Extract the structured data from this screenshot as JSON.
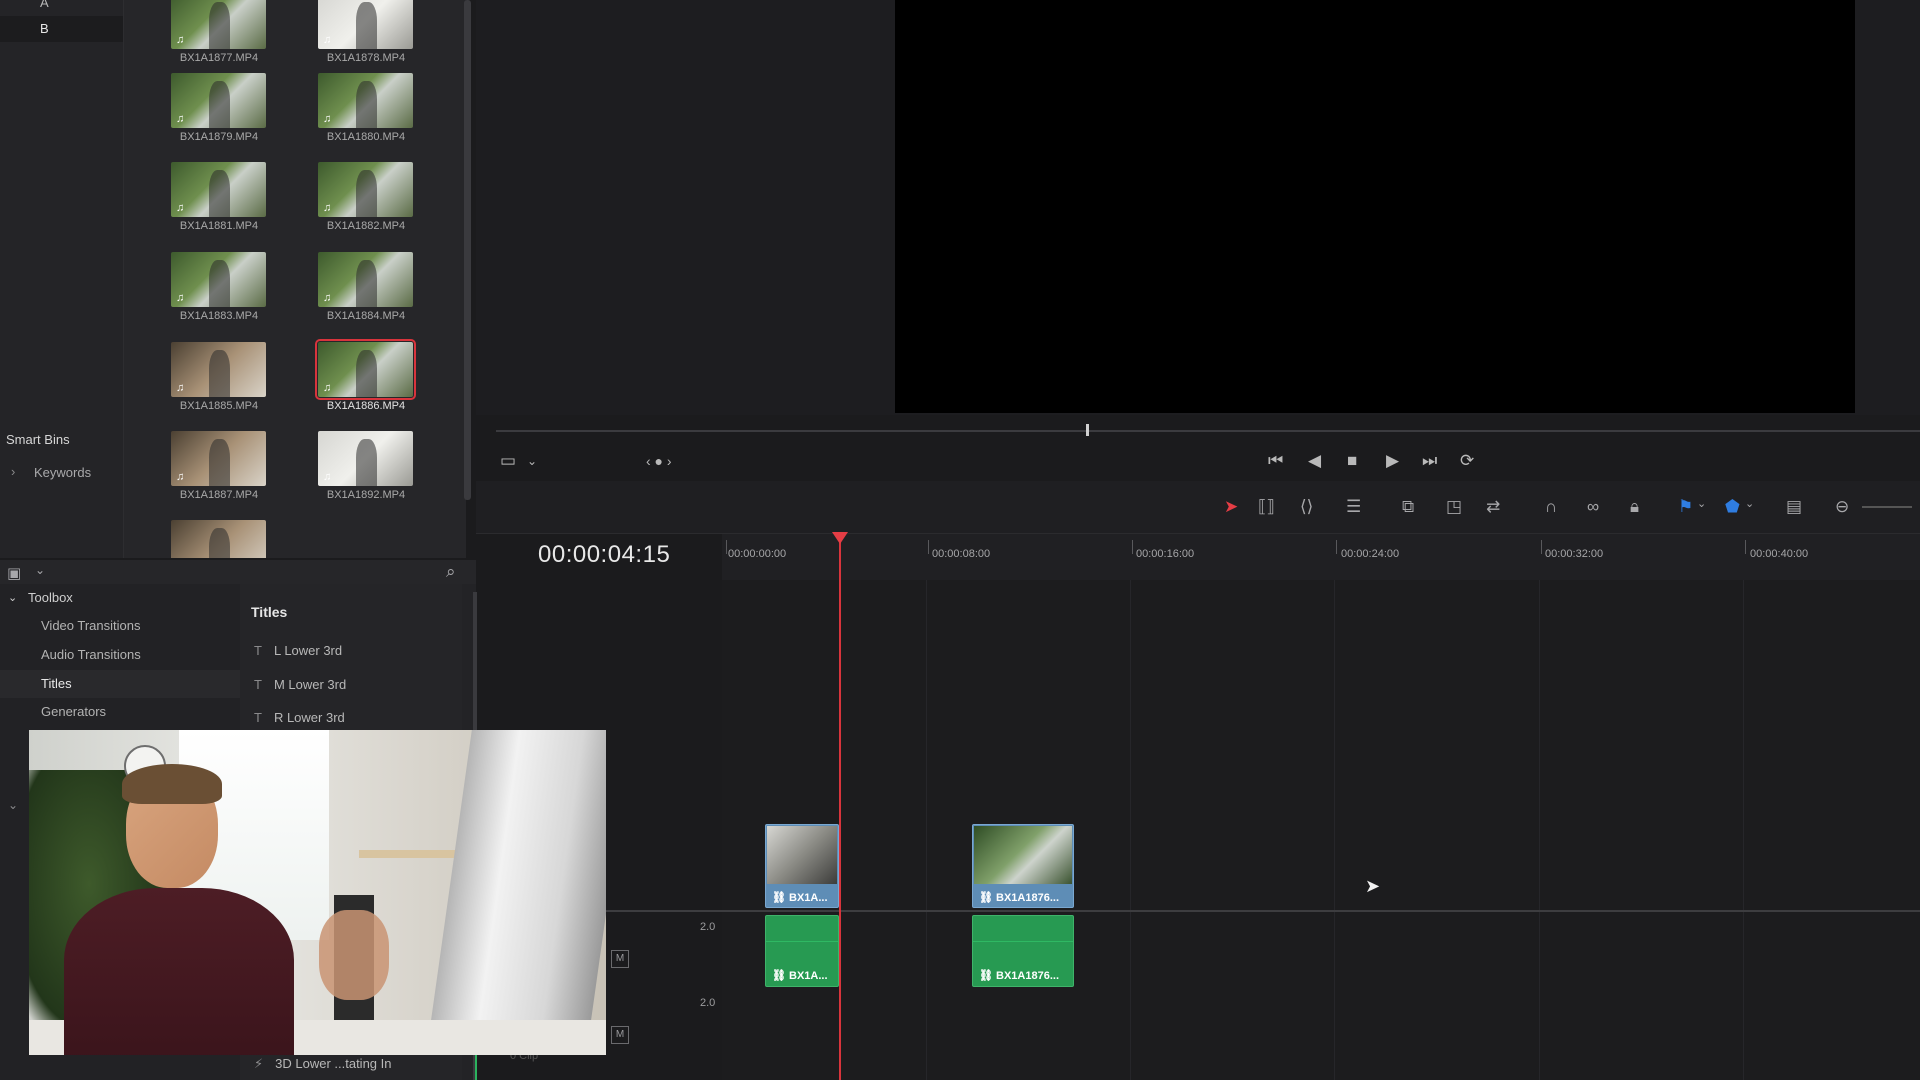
{
  "bins": {
    "items": [
      {
        "label": "A"
      },
      {
        "label": "B"
      }
    ],
    "selected": "B"
  },
  "smart_bins": {
    "heading": "Smart Bins",
    "keywords": "Keywords"
  },
  "media_pool": {
    "clips": [
      {
        "name": "BX1A1877.MP4"
      },
      {
        "name": "BX1A1878.MP4"
      },
      {
        "name": "BX1A1879.MP4"
      },
      {
        "name": "BX1A1880.MP4"
      },
      {
        "name": "BX1A1881.MP4"
      },
      {
        "name": "BX1A1882.MP4"
      },
      {
        "name": "BX1A1883.MP4"
      },
      {
        "name": "BX1A1884.MP4"
      },
      {
        "name": "BX1A1885.MP4"
      },
      {
        "name": "BX1A1886.MP4",
        "selected": true
      },
      {
        "name": "BX1A1887.MP4"
      },
      {
        "name": "BX1A1892.MP4"
      }
    ]
  },
  "toolbox": {
    "heading": "Toolbox",
    "items": [
      {
        "label": "Video Transitions"
      },
      {
        "label": "Audio Transitions"
      },
      {
        "label": "Titles",
        "selected": true
      },
      {
        "label": "Generators"
      }
    ]
  },
  "titles_panel": {
    "heading": "Titles",
    "items": [
      {
        "label": "L Lower 3rd"
      },
      {
        "label": "M Lower 3rd"
      },
      {
        "label": "R Lower 3rd"
      },
      {
        "label": "3D Lower ...tating In"
      }
    ]
  },
  "timeline": {
    "timecode": "00:00:04:15",
    "ruler": [
      "00:00:00:00",
      "00:00:08:00",
      "00:00:16:00",
      "00:00:24:00",
      "00:00:32:00",
      "00:00:40:00"
    ],
    "video_clips": [
      {
        "label": "BX1A..."
      },
      {
        "label": "BX1A1876..."
      }
    ],
    "audio_clips": [
      {
        "label": "BX1A..."
      },
      {
        "label": "BX1A1876..."
      }
    ],
    "audio_tracks": [
      {
        "level": "2.0",
        "mute": "M"
      },
      {
        "level": "2.0",
        "mute": "M"
      }
    ],
    "footer_hint": "0 Clip"
  },
  "icons": {
    "note": "♫",
    "link": "🔗",
    "title": "T",
    "effect": "⚡",
    "chevron_down": "⌄",
    "chevron_right": "›",
    "search": "⌕"
  },
  "colors": {
    "accent_red": "#d8343c",
    "video_clip": "#5e8db6",
    "audio_clip": "#279a52",
    "flag_blue": "#2f7de1"
  }
}
